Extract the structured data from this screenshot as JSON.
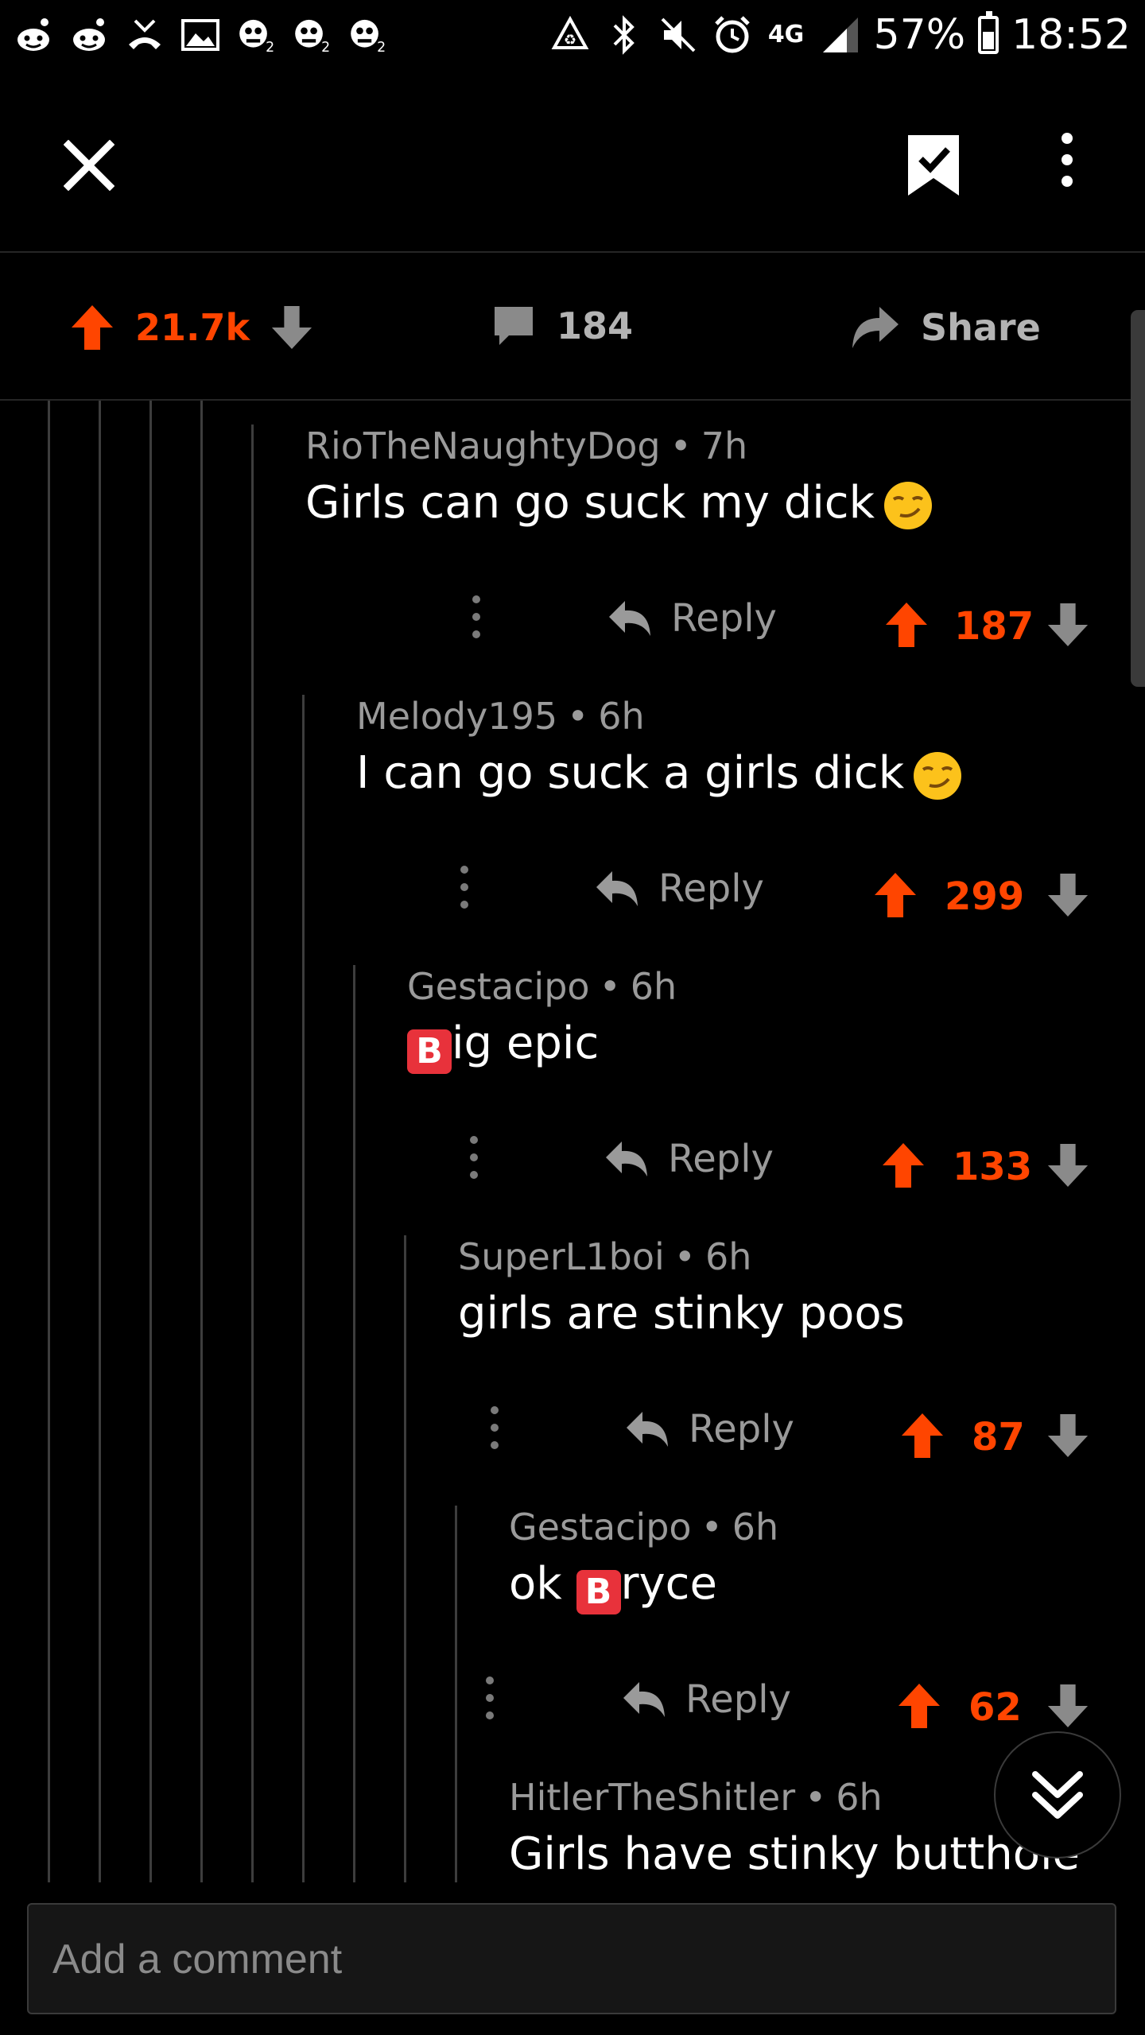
{
  "status_bar": {
    "battery": "57%",
    "time": "18:52",
    "network": "4G",
    "left_icons": [
      "reddit-icon",
      "reddit-icon",
      "missed-call-icon",
      "image-icon",
      "zombie-icon",
      "zombie-icon",
      "zombie-icon"
    ],
    "right_icons": [
      "recycle-icon",
      "bluetooth-icon",
      "mute-icon",
      "alarm-icon",
      "4g-icon",
      "signal-icon"
    ]
  },
  "toolbar": {
    "icons": [
      "close-icon",
      "bookmark-saved-icon",
      "more-vert-icon"
    ]
  },
  "post_actions": {
    "score": "21.7k",
    "comments": "184",
    "share_label": "Share"
  },
  "comments": [
    {
      "author": "RioTheNaughtyDog",
      "age": "7h",
      "body": "Girls can go suck my dick",
      "emoji": "smirk-emoji",
      "score": "187",
      "reply_label": "Reply"
    },
    {
      "author": "Melody195",
      "age": "6h",
      "body": "I can go suck a girls dick",
      "emoji": "smirk-emoji",
      "score": "299",
      "reply_label": "Reply"
    },
    {
      "author": "Gestacipo",
      "age": "6h",
      "body_prefix": "B",
      "body": "ig epic",
      "score": "133",
      "reply_label": "Reply"
    },
    {
      "author": "SuperL1boi",
      "age": "6h",
      "body": "girls are stinky poos",
      "score": "87",
      "reply_label": "Reply"
    },
    {
      "author": "Gestacipo",
      "age": "6h",
      "body_before": "ok ",
      "body_prefix": "B",
      "body": "ryce",
      "score": "62",
      "reply_label": "Reply"
    },
    {
      "author": "HitlerTheShitler",
      "age": "6h",
      "body": "Girls have stinky butthole"
    }
  ],
  "composer": {
    "placeholder": "Add a comment"
  },
  "colors": {
    "accent": "#ff4500",
    "background": "#000000",
    "muted_text": "#9a9a9a",
    "thread_line": "#3d3d3d",
    "input_background": "#161616"
  }
}
